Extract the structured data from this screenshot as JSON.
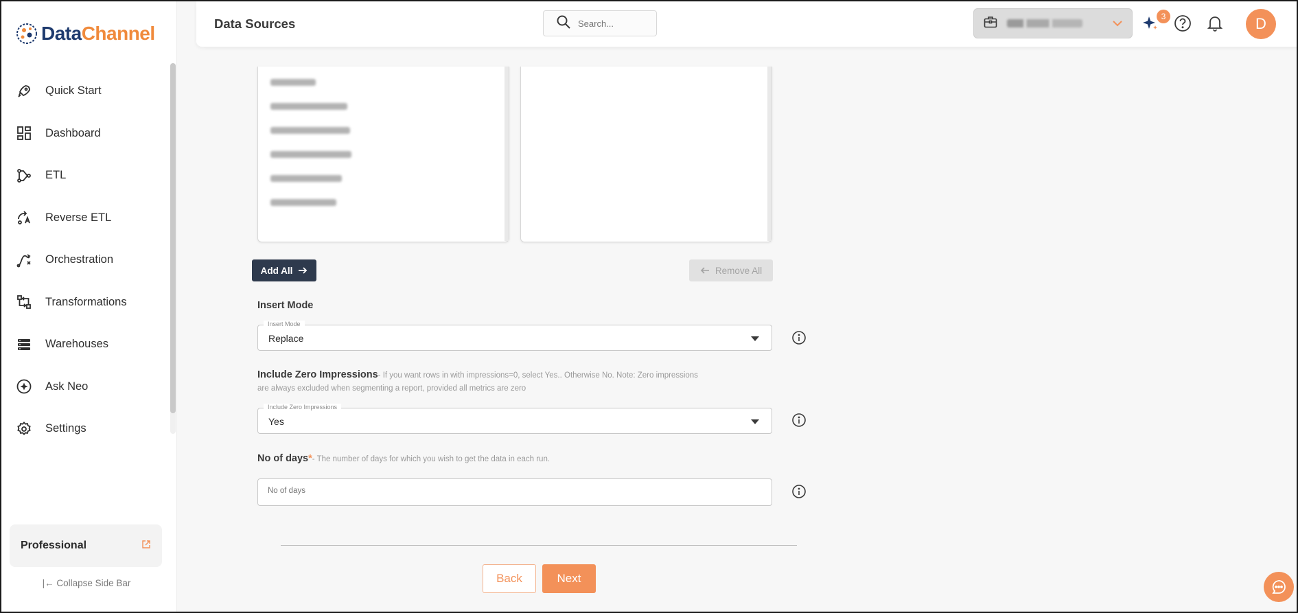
{
  "brand": {
    "part1": "Data",
    "part2": "Channel"
  },
  "sidebar": {
    "items": [
      {
        "label": "Quick Start",
        "icon": "rocket-icon"
      },
      {
        "label": "Dashboard",
        "icon": "dashboard-icon"
      },
      {
        "label": "ETL",
        "icon": "etl-icon"
      },
      {
        "label": "Reverse ETL",
        "icon": "reverse-etl-icon"
      },
      {
        "label": "Orchestration",
        "icon": "orchestration-icon"
      },
      {
        "label": "Transformations",
        "icon": "transformations-icon"
      },
      {
        "label": "Warehouses",
        "icon": "warehouses-icon"
      },
      {
        "label": "Ask Neo",
        "icon": "sparkle-icon"
      },
      {
        "label": "Settings",
        "icon": "gear-icon"
      }
    ],
    "plan": "Professional",
    "collapse_label": "Collapse Side Bar"
  },
  "header": {
    "title": "Data Sources",
    "search_placeholder": "Search...",
    "notification_badge": "3",
    "avatar_initial": "D"
  },
  "main": {
    "add_all_label": "Add All",
    "remove_all_label": "Remove All",
    "insert_mode": {
      "section_label": "Insert Mode",
      "floating_label": "Insert Mode",
      "value": "Replace"
    },
    "zero_impressions": {
      "section_label": "Include Zero Impressions",
      "hint_line1": "- If you want rows in with impressions=0, select Yes.. Otherwise No. Note: Zero impressions",
      "hint_line2": "are always excluded when segmenting a report, provided all metrics are zero",
      "floating_label": "Include Zero Impressions",
      "value": "Yes"
    },
    "no_of_days": {
      "section_label": "No of days",
      "required_mark": "*",
      "hint": "- The number of days for which you wish to get the data in each run.",
      "placeholder": "No of days"
    },
    "back_label": "Back",
    "next_label": "Next"
  },
  "colors": {
    "accent": "#f39159",
    "brand_navy": "#1e3a6e",
    "dark_button": "#2e3a4d"
  }
}
